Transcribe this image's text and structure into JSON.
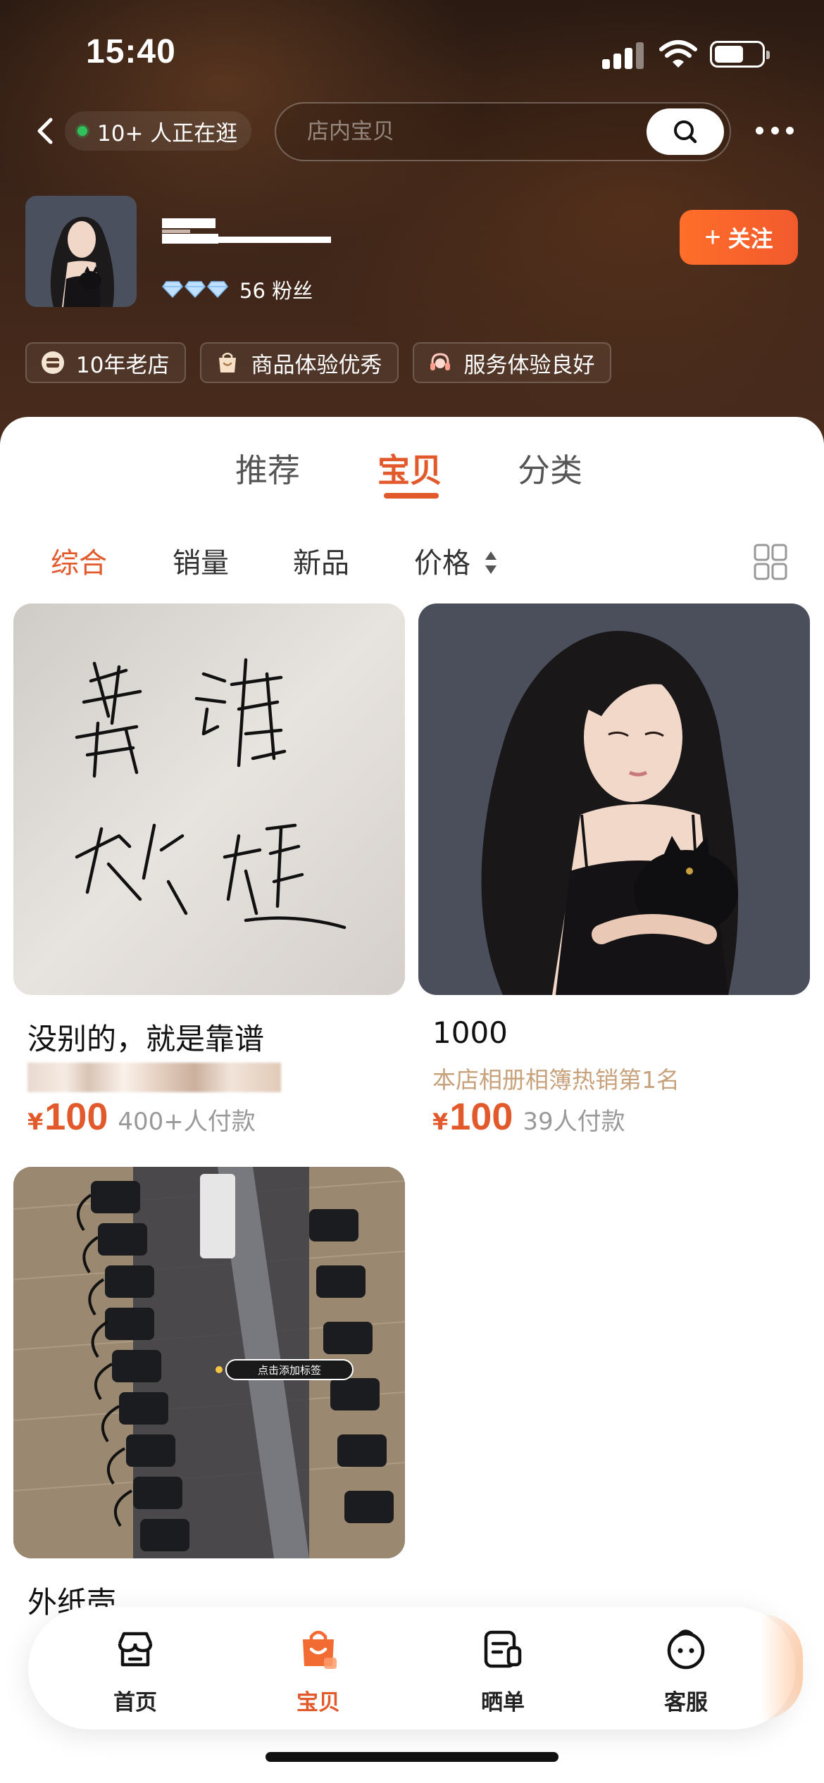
{
  "status_bar": {
    "time": "15:40"
  },
  "header": {
    "visitors_text": "10+ 人正在逛",
    "search_placeholder": "店内宝贝"
  },
  "shop": {
    "fans_text": "56 粉丝",
    "follow_label": "关注",
    "badges": [
      {
        "label": "10年老店",
        "icon": "shop-badge-icon"
      },
      {
        "label": "商品体验优秀",
        "icon": "bag-badge-icon"
      },
      {
        "label": "服务体验良好",
        "icon": "headset-badge-icon"
      }
    ]
  },
  "tabs": [
    {
      "label": "推荐",
      "active": false
    },
    {
      "label": "宝贝",
      "active": true
    },
    {
      "label": "分类",
      "active": false
    }
  ],
  "sort": [
    {
      "label": "综合",
      "active": true
    },
    {
      "label": "销量",
      "active": false
    },
    {
      "label": "新品",
      "active": false
    },
    {
      "label": "价格",
      "active": false
    }
  ],
  "products": [
    {
      "title": "没别的，就是靠谱",
      "subtitle": "",
      "yen": "¥",
      "price": "100",
      "sold": "400+人付款",
      "image": "handwriting-note"
    },
    {
      "title": "1000",
      "subtitle": "本店相册相簿热销第1名",
      "yen": "¥",
      "price": "100",
      "sold": "39人付款",
      "image": "illustrated-girl-with-cat"
    },
    {
      "title": "外纸壳",
      "subtitle": "",
      "yen": "",
      "price": "",
      "sold": "",
      "image": "desk-phones",
      "image_label": "点击添加标签"
    }
  ],
  "bottom_nav": [
    {
      "label": "首页",
      "icon": "store-icon",
      "active": false
    },
    {
      "label": "宝贝",
      "icon": "bag-icon",
      "active": true
    },
    {
      "label": "晒单",
      "icon": "review-icon",
      "active": false
    },
    {
      "label": "客服",
      "icon": "service-icon",
      "active": false
    }
  ],
  "colors": {
    "accent": "#e2592b",
    "header_dark": "#3b2418",
    "follow_orange": "#ff6e2a",
    "subtitle_tan": "#c8a27c"
  }
}
